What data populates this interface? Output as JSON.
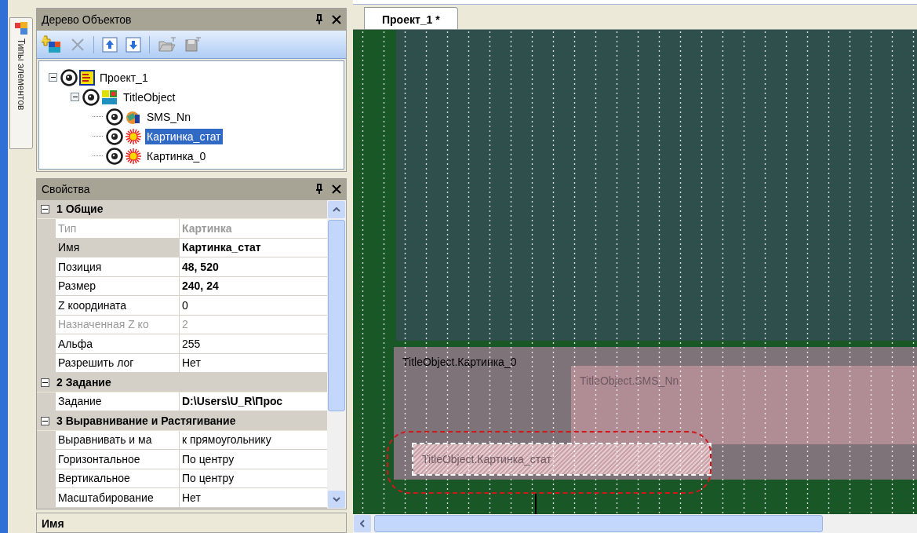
{
  "side_tab": {
    "label": "Типы элементов"
  },
  "object_tree": {
    "title": "Дерево Объектов",
    "items": [
      {
        "label": "Проект_1",
        "kind": "project",
        "expanded": true,
        "selected": false,
        "children": [
          {
            "label": "TitleObject",
            "kind": "title",
            "expanded": true,
            "selected": false,
            "children": [
              {
                "label": "SMS_Nn",
                "kind": "sms",
                "selected": false
              },
              {
                "label": "Картинка_стат",
                "kind": "picture",
                "selected": true
              },
              {
                "label": "Картинка_0",
                "kind": "picture",
                "selected": false
              }
            ]
          }
        ]
      }
    ]
  },
  "properties": {
    "title": "Свойства",
    "sections": [
      {
        "title": "1 Общие",
        "expanded": true,
        "rows": [
          {
            "name": "Тип",
            "value": "Картинка",
            "disabled": true,
            "bold": true
          },
          {
            "name": "Имя",
            "value": "Картинка_стат",
            "disabled": false,
            "bold": true,
            "selected": true
          },
          {
            "name": "Позиция",
            "value": "48, 520",
            "disabled": false,
            "bold": true
          },
          {
            "name": "Размер",
            "value": "240, 24",
            "disabled": false,
            "bold": true
          },
          {
            "name": "Z координата",
            "value": "0",
            "disabled": false,
            "bold": false
          },
          {
            "name": "Назначенная Z ко",
            "value": "2",
            "disabled": true,
            "bold": false
          },
          {
            "name": "Альфа",
            "value": "255",
            "disabled": false,
            "bold": false
          },
          {
            "name": "Разрешить лог",
            "value": "Нет",
            "disabled": false,
            "bold": false
          }
        ]
      },
      {
        "title": "2 Задание",
        "expanded": true,
        "rows": [
          {
            "name": "Задание",
            "value": "D:\\Users\\U_R\\Прос",
            "disabled": false,
            "bold": true
          }
        ]
      },
      {
        "title": "3 Выравнивание и Растягивание",
        "expanded": true,
        "rows": [
          {
            "name": "Выравнивать и ма",
            "value": "к прямоугольнику",
            "disabled": false,
            "bold": false
          },
          {
            "name": "Горизонтальное",
            "value": "По центру",
            "disabled": false,
            "bold": false
          },
          {
            "name": "Вертикальное",
            "value": "По центру",
            "disabled": false,
            "bold": false
          },
          {
            "name": "Масштабирование",
            "value": "Нет",
            "disabled": false,
            "bold": false
          }
        ]
      }
    ],
    "description_title": "Имя"
  },
  "editor": {
    "tabs": [
      {
        "label": "Проект_1 *",
        "selected": true
      }
    ],
    "objects": [
      {
        "label": "TitleObject.Картинка_0",
        "kind": "back",
        "selected": false
      },
      {
        "label": "TitleObject.SMS_Nn",
        "kind": "pink",
        "selected": false
      },
      {
        "label": "TitleObject.Картинка_стат",
        "kind": "pink",
        "selected": true
      }
    ]
  }
}
